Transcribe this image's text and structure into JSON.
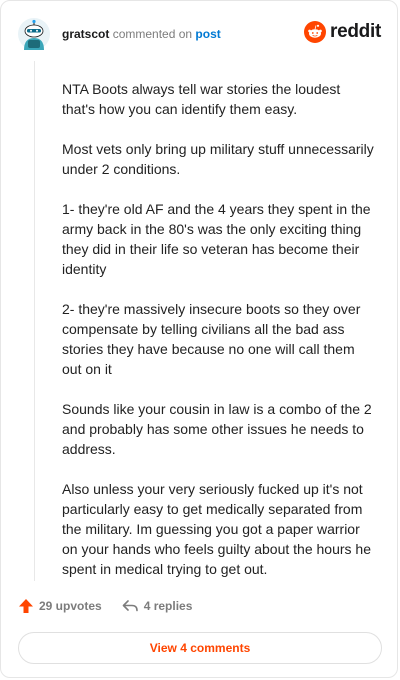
{
  "header": {
    "username": "gratscot",
    "action_text": "commented on",
    "post_link": "post"
  },
  "brand": {
    "name": "reddit",
    "logo_icon": "reddit-logo-icon",
    "accent_color": "#ff4500"
  },
  "comment": {
    "paragraphs": [
      "NTA Boots always tell war stories the loudest that's how you can identify them easy.",
      "Most vets only bring up military stuff unnecessarily under 2 conditions.",
      "1- they're old AF and the 4 years they spent in the army back in the 80's was the only exciting thing they did in their life so veteran has become their identity",
      "2- they're massively insecure boots so they over compensate by telling civilians all the bad ass stories they have because no one will call them out on it",
      "Sounds like your cousin in law is a combo of the 2 and probably has some other issues he needs to address.",
      "Also unless your very seriously fucked up it's not particularly easy to get medically separated from the military. Im guessing you got a paper warrior on your hands who feels guilty about the hours he spent in medical trying to get out."
    ]
  },
  "footer": {
    "upvotes": "29 upvotes",
    "upvote_icon": "upvote-arrow-icon",
    "replies": "4 replies",
    "reply_icon": "reply-arrow-icon"
  },
  "view_comments_label": "View 4 comments"
}
